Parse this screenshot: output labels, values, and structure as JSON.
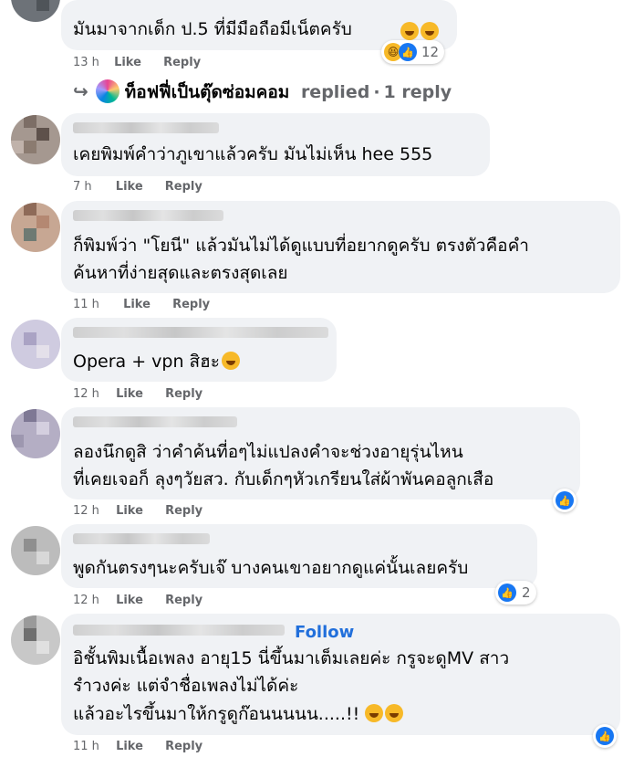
{
  "comments": [
    {
      "text_lines": [
        "มันมาจากเด็ก ป.5 ที่มีมือถือมีเน็ตครับ"
      ],
      "time": "13 h",
      "like": "Like",
      "reply": "Reply",
      "reaction_count": "12"
    },
    {
      "text_lines": [
        "เคยพิมพ์คำว่าภูเขาแล้วครับ มันไม่เห็น hee 555"
      ],
      "time": "7 h",
      "like": "Like",
      "reply": "Reply"
    },
    {
      "text_lines": [
        "ก็พิมพ์ว่า \"โยนี\" แล้วมันไม่ได้ดูแบบที่อยากดูครับ ตรงตัวคือคำ",
        "ค้นหาที่ง่ายสุดและตรงสุดเลย"
      ],
      "time": "11 h",
      "like": "Like",
      "reply": "Reply"
    },
    {
      "text_lines": [
        "Opera + vpn สิฮะ"
      ],
      "time": "12 h",
      "like": "Like",
      "reply": "Reply"
    },
    {
      "text_lines": [
        "ลองนึกดูสิ ว่าคำค้นที่อๆไม่แปลงคำจะช่วงอายุรุ่นไหน",
        "ที่เคยเจอก็ ลุงๆวัยสว. กับเด็กๆหัวเกรียนใส่ผ้าพันคอลูกเสือ"
      ],
      "time": "12 h",
      "like": "Like",
      "reply": "Reply"
    },
    {
      "text_lines": [
        "พูดกันตรงๆนะครับเจ๊ บางคนเขาอยากดูแค่นั้นเลยครับ"
      ],
      "time": "12 h",
      "like": "Like",
      "reply": "Reply",
      "reaction_count": "2"
    },
    {
      "text_lines": [
        "อิชั้นพิมเนื้อเพลง อายุ15 นี่ขึ้นมาเต็มเลยค่ะ กรูจะดูMV สาว",
        "รำวงค่ะ แต่จำชื่อเพลงไม่ได้ค่ะ",
        "แล้วอะไรขึ้นมาให้กรูดูก๊อนนนนน.....!!"
      ],
      "time": "11 h",
      "like": "Like",
      "reply": "Reply",
      "follow": "Follow"
    }
  ],
  "reply_thread": {
    "name": "ท็อฟฟี่เป็นตุ๊ดซ่อมคอม",
    "label": "replied",
    "dot": "·",
    "count": "1 reply"
  },
  "icons": {
    "like": "like-icon",
    "haha": "haha-icon",
    "reply_arrow": "reply-arrow-icon"
  },
  "colors": {
    "bubble": "#f0f2f5",
    "link": "#216fdb",
    "meta": "#65676b",
    "like_blue": "#1877f2"
  }
}
